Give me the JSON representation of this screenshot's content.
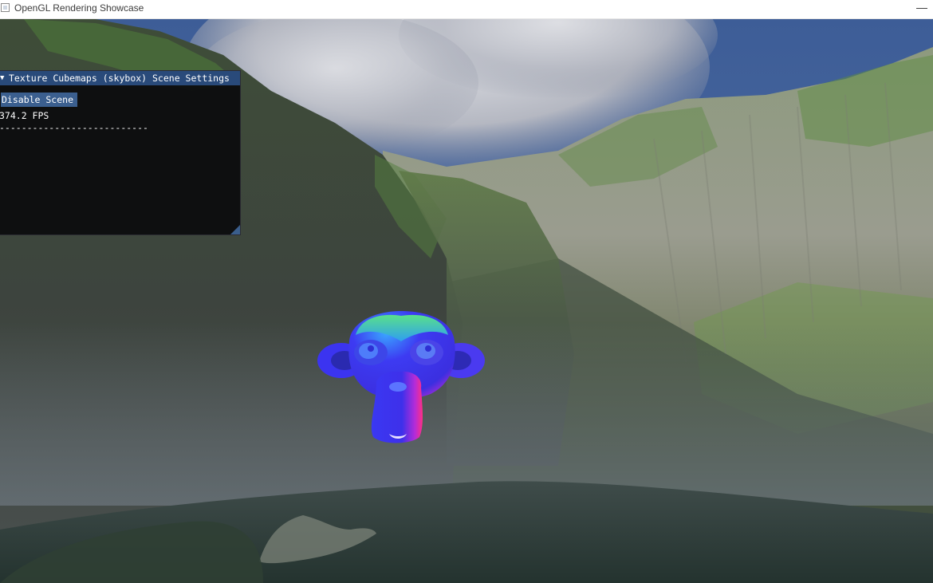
{
  "window": {
    "title": "OpenGL Rendering Showcase",
    "close_glyph": "—",
    "icons": {
      "app": "app-window-icon",
      "close": "minimize-icon"
    }
  },
  "scene": {
    "background": "skybox-mountain-lake",
    "model": "suzanne-monkey-head-normal-shaded",
    "colors": {
      "sky": "#3f5f97",
      "cloud": "#c9ccd3",
      "rock": "#6b7263",
      "grass": "#4f7a3a",
      "water": "#3c4a4b",
      "model_blue": "#3b36f0",
      "model_green": "#32d67a",
      "model_magenta": "#d72fd0"
    }
  },
  "settings_panel": {
    "title": "Texture Cubemaps (skybox) Scene Settings",
    "collapse_glyph": "▼",
    "disable_button_label": "Disable Scene",
    "fps_text": "374.2 FPS",
    "separator_text": "---------------------------",
    "colors": {
      "title_bg": "#294a7a",
      "button_bg": "#3b5f8f",
      "panel_bg": "#0c0c0e"
    }
  }
}
